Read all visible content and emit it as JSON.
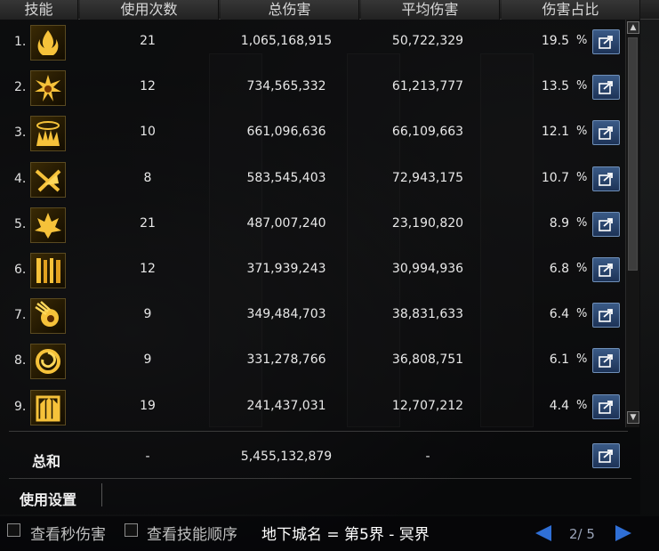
{
  "headers": {
    "skill": "技能",
    "uses": "使用次数",
    "total": "总伤害",
    "avg": "平均伤害",
    "share": "伤害占比"
  },
  "rows": [
    {
      "rank": "1.",
      "icon": "flame-sigil-icon",
      "uses": "21",
      "total": "1,065,168,915",
      "avg": "50,722,329",
      "share": "19.5",
      "pct": "%"
    },
    {
      "rank": "2.",
      "icon": "starburst-seal-icon",
      "uses": "12",
      "total": "734,565,332",
      "avg": "61,213,777",
      "share": "13.5",
      "pct": "%"
    },
    {
      "rank": "3.",
      "icon": "fire-crown-icon",
      "uses": "10",
      "total": "661,096,636",
      "avg": "66,109,663",
      "share": "12.1",
      "pct": "%"
    },
    {
      "rank": "4.",
      "icon": "crossed-blades-icon",
      "uses": "8",
      "total": "583,545,403",
      "avg": "72,943,175",
      "share": "10.7",
      "pct": "%"
    },
    {
      "rank": "5.",
      "icon": "lotus-flame-icon",
      "uses": "21",
      "total": "487,007,240",
      "avg": "23,190,820",
      "share": "8.9",
      "pct": "%"
    },
    {
      "rank": "6.",
      "icon": "flame-pillars-icon",
      "uses": "12",
      "total": "371,939,243",
      "avg": "30,994,936",
      "share": "6.8",
      "pct": "%"
    },
    {
      "rank": "7.",
      "icon": "blazing-fist-icon",
      "uses": "9",
      "total": "349,484,703",
      "avg": "38,831,633",
      "share": "6.4",
      "pct": "%"
    },
    {
      "rank": "8.",
      "icon": "fire-vortex-icon",
      "uses": "9",
      "total": "331,278,766",
      "avg": "36,808,751",
      "share": "6.1",
      "pct": "%"
    },
    {
      "rank": "9.",
      "icon": "flame-gate-icon",
      "uses": "19",
      "total": "241,437,031",
      "avg": "12,707,212",
      "share": "4.4",
      "pct": "%"
    }
  ],
  "summary": {
    "label": "总和",
    "uses": "-",
    "total": "5,455,132,879",
    "avg": "-"
  },
  "settings_label": "使用设置",
  "footer": {
    "check_seconds_damage": "查看秒伤害",
    "check_skill_order": "查看技能顺序",
    "dungeon": "地下城名 = 第5界 - 冥界",
    "page": "2/ 5"
  },
  "colors": {
    "share_button": "#2a4a78",
    "pager_arrow": "#2f6fd6"
  }
}
